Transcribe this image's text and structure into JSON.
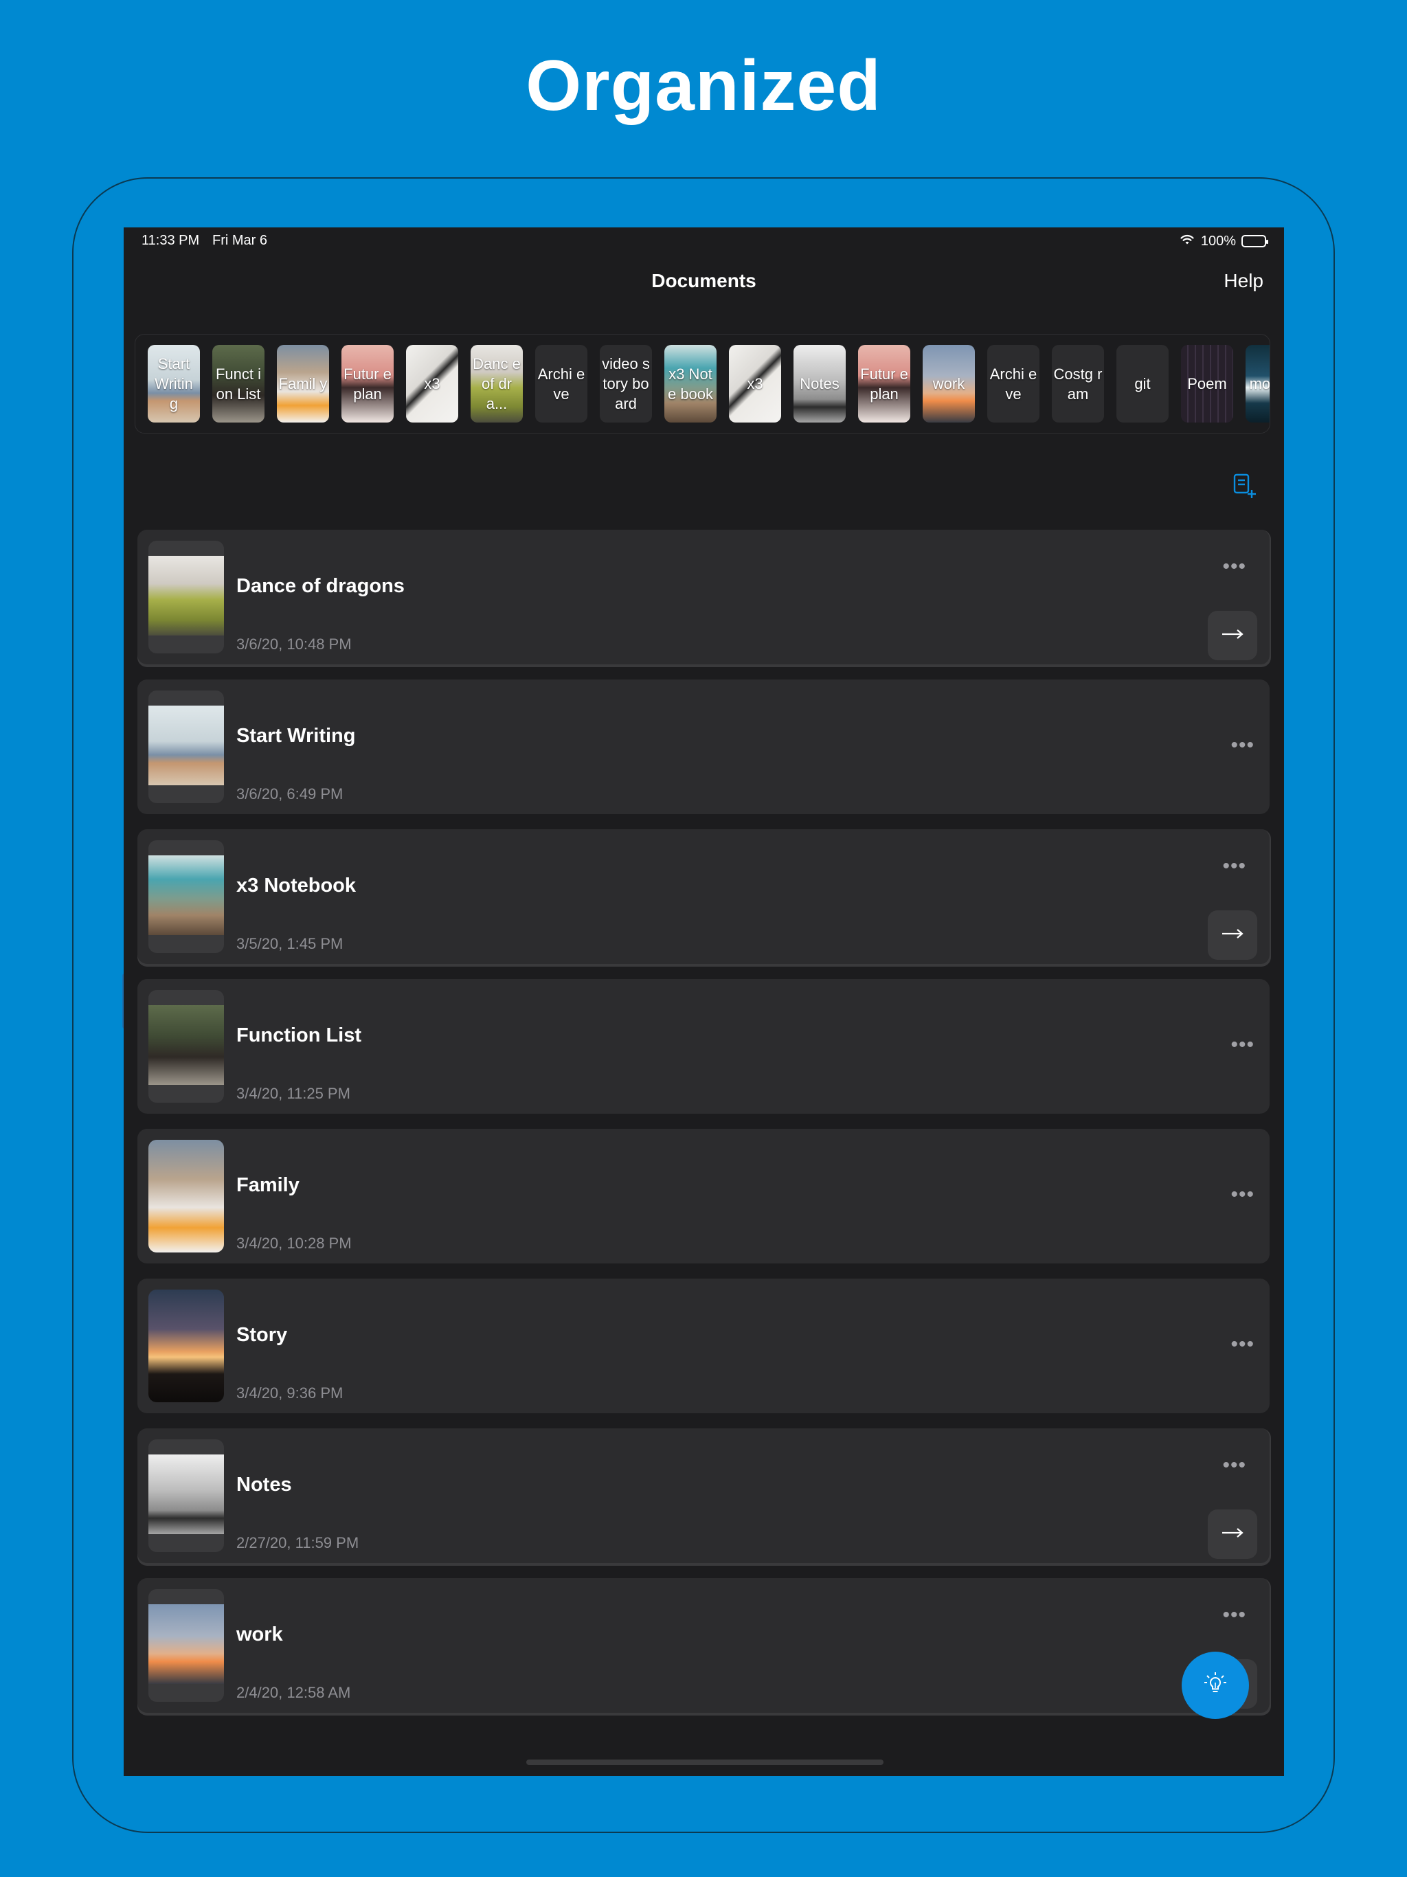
{
  "headline": "Organized",
  "status_bar": {
    "time": "11:33 PM",
    "date": "Fri Mar 6",
    "battery": "100%",
    "battery_level": 1.0
  },
  "nav": {
    "title": "Documents",
    "help": "Help"
  },
  "strip": {
    "chips": [
      {
        "label": "Start Writin g",
        "theme": "dog"
      },
      {
        "label": "Funct ion List",
        "theme": "moto"
      },
      {
        "label": "Famil y",
        "theme": "family"
      },
      {
        "label": "Futur e plan",
        "theme": "pink"
      },
      {
        "label": "x3",
        "theme": "paper"
      },
      {
        "label": "Danc e of dra...",
        "theme": "car"
      },
      {
        "label": "Archi eve",
        "theme": "plain"
      },
      {
        "label": "video story board",
        "theme": "plain"
      },
      {
        "label": "x3 Note book",
        "theme": "teal"
      },
      {
        "label": "x3",
        "theme": "paper"
      },
      {
        "label": "Notes",
        "theme": "fog"
      },
      {
        "label": "Futur e plan",
        "theme": "pink"
      },
      {
        "label": "work",
        "theme": "dusk"
      },
      {
        "label": "Archi eve",
        "theme": "plain"
      },
      {
        "label": "Costg ram",
        "theme": "plain"
      },
      {
        "label": "git",
        "theme": "plain"
      },
      {
        "label": "Poem",
        "theme": "poem"
      },
      {
        "label": "mo dic",
        "theme": "ocean"
      }
    ]
  },
  "documents": [
    {
      "title": "Dance of dragons",
      "date": "3/6/20, 10:48 PM",
      "thumb": "car",
      "swiped": true
    },
    {
      "title": "Start Writing",
      "date": "3/6/20, 6:49 PM",
      "thumb": "dog",
      "swiped": false
    },
    {
      "title": "x3 Notebook",
      "date": "3/5/20, 1:45 PM",
      "thumb": "teal",
      "swiped": true
    },
    {
      "title": "Function List",
      "date": "3/4/20, 11:25 PM",
      "thumb": "moto",
      "swiped": false
    },
    {
      "title": "Family",
      "date": "3/4/20, 10:28 PM",
      "thumb": "family",
      "swiped": false
    },
    {
      "title": "Story",
      "date": "3/4/20, 9:36 PM",
      "thumb": "sunset",
      "swiped": false
    },
    {
      "title": "Notes",
      "date": "2/27/20, 11:59 PM",
      "thumb": "fog",
      "swiped": true
    },
    {
      "title": "work",
      "date": "2/4/20, 12:58 AM",
      "thumb": "dusk",
      "swiped": true
    }
  ],
  "more_glyph": "•••",
  "colors": {
    "background": "#0089d1",
    "screen": "#1c1c1e",
    "card": "#2c2c2e",
    "accent": "#0a8ee0"
  },
  "icons": {
    "add_document": "add-document-icon",
    "open": "arrow-right-icon",
    "more": "more-dots-icon",
    "fab": "lightbulb-icon"
  }
}
